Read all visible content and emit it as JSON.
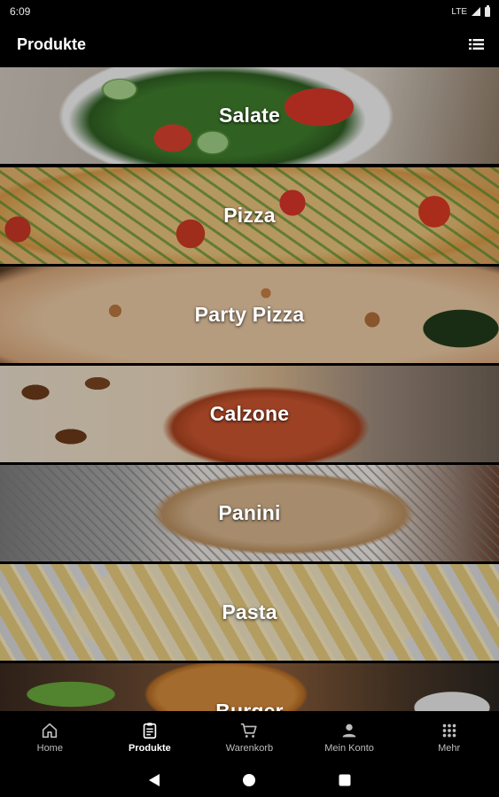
{
  "status_bar": {
    "time": "6:09",
    "network": "LTE"
  },
  "app_bar": {
    "title": "Produkte",
    "menu_icon": "list-icon"
  },
  "categories": [
    {
      "label": "Salate"
    },
    {
      "label": "Pizza"
    },
    {
      "label": "Party Pizza"
    },
    {
      "label": "Calzone"
    },
    {
      "label": "Panini"
    },
    {
      "label": "Pasta"
    },
    {
      "label": "Burger"
    }
  ],
  "bottom_nav": [
    {
      "label": "Home",
      "icon": "home-icon",
      "active": false
    },
    {
      "label": "Produkte",
      "icon": "clipboard-icon",
      "active": true
    },
    {
      "label": "Warenkorb",
      "icon": "cart-icon",
      "active": false
    },
    {
      "label": "Mein Konto",
      "icon": "person-icon",
      "active": false
    },
    {
      "label": "Mehr",
      "icon": "grid-icon",
      "active": false
    }
  ],
  "colors": {
    "background": "#000000",
    "text": "#ffffff",
    "inactive_label": "#bdbdbd"
  }
}
